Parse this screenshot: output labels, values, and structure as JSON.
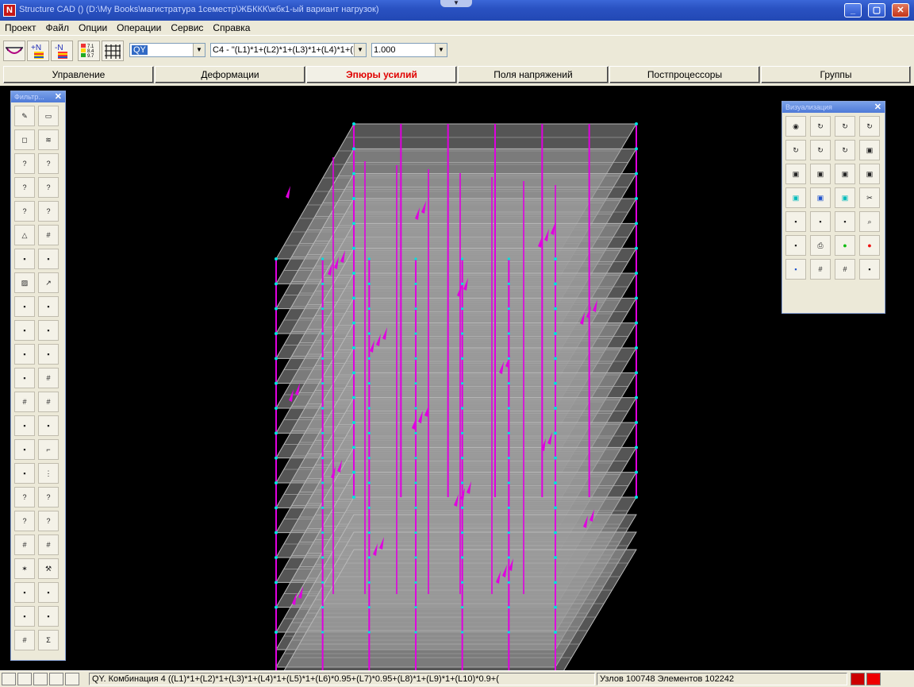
{
  "window": {
    "title": "Structure CAD () (D:\\My Books\\магистратура 1семестр\\ЖБККК\\жбк1-ый вариант нагрузок)",
    "app_icon": "N",
    "buttons": {
      "minimize": "_",
      "maximize": "▢",
      "close": "✕"
    }
  },
  "menu": [
    "Проект",
    "Файл",
    "Опции",
    "Операции",
    "Сервис",
    "Справка"
  ],
  "toolbar": {
    "force_combo": "QY",
    "combination_combo": "C4 - \"(L1)*1+(L2)*1+(L3)*1+(L4)*1+(L5",
    "scale_combo": "1.000",
    "icon_labels": {
      "n_plus": "+N",
      "n_minus": "-N",
      "scale_values": [
        "7.1",
        "8.4",
        "9.7"
      ]
    }
  },
  "tabs": [
    "Управление",
    "Деформации",
    "Эпюры усилий",
    "Поля напряжений",
    "Постпроцессоры",
    "Группы"
  ],
  "active_tab": "Эпюры усилий",
  "left_palette": {
    "title": "Фильтр...",
    "buttons": [
      "pencil",
      "eraser",
      "cube",
      "spring",
      "node-1",
      "node-x",
      "node-vne",
      "node-n",
      "node-te",
      "node-r",
      "triangle",
      "grid-x",
      "cross-1",
      "cross-2",
      "hatch",
      "arrow",
      "dim-1",
      "dim-2",
      "arrow-f",
      "arrow-e",
      "arrow-m",
      "ruler",
      "xy-axis",
      "grid-color",
      "grid-pink",
      "grid-b",
      "ruler-2",
      "ruler-3",
      "shape-3",
      "brush",
      "stack",
      "filter",
      "node-n2",
      "node-g",
      "node-g2",
      "node-x2",
      "grid-plain",
      "grid-red",
      "star",
      "wrench",
      "bars-r",
      "beam-g",
      "layers",
      "arrows",
      "grid-y",
      "sum"
    ]
  },
  "right_palette": {
    "title": "Визуализация",
    "buttons": [
      "globe",
      "rotate-x",
      "rotate-x2",
      "rotate-z",
      "rotate-y",
      "rotate-xy",
      "rotate-xz",
      "box-3d",
      "box-front",
      "box-side",
      "box-top",
      "box-iso",
      "box-cyan",
      "box-blue",
      "box-teal",
      "scissors",
      "frame-grid",
      "fragment",
      "layers-down",
      "zoom",
      "no-entry",
      "printer",
      "ball-green",
      "ball-red",
      "screen-blue",
      "grid-pink",
      "grid-green",
      "undo-gray"
    ]
  },
  "status": {
    "message": "QY. Комбинация 4 ((L1)*1+(L2)*1+(L3)*1+(L4)*1+(L5)*1+(L6)*0.95+(L7)*0.95+(L8)*1+(L9)*1+(L10)*0.9+(",
    "counts": "Узлов 100748 Элементов 102242"
  },
  "colors": {
    "background": "#000000",
    "mesh": "#b9b9b9",
    "diagram": "#e000e0",
    "nodes": "#00e0e0",
    "active_tab_text": "#e00000"
  }
}
